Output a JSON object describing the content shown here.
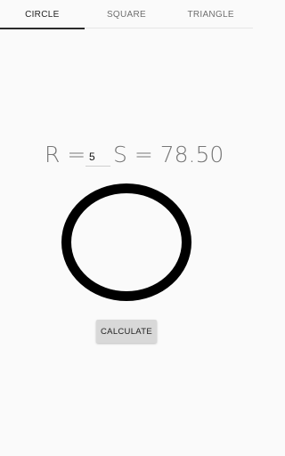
{
  "tabs": [
    {
      "label": "CIRCLE",
      "active": true
    },
    {
      "label": "SQUARE",
      "active": false
    },
    {
      "label": "TRIANGLE",
      "active": false
    }
  ],
  "formula": {
    "r_label": "R =",
    "r_value": "5",
    "result_text": "S = 78.50"
  },
  "shape": {
    "type": "circle",
    "stroke_color": "#000000"
  },
  "calculate_button": {
    "label": "CALCULATE"
  },
  "colors": {
    "background": "#fafafa",
    "tab_indicator": "#2a2a2a",
    "button_bg": "#d8d8d8"
  }
}
